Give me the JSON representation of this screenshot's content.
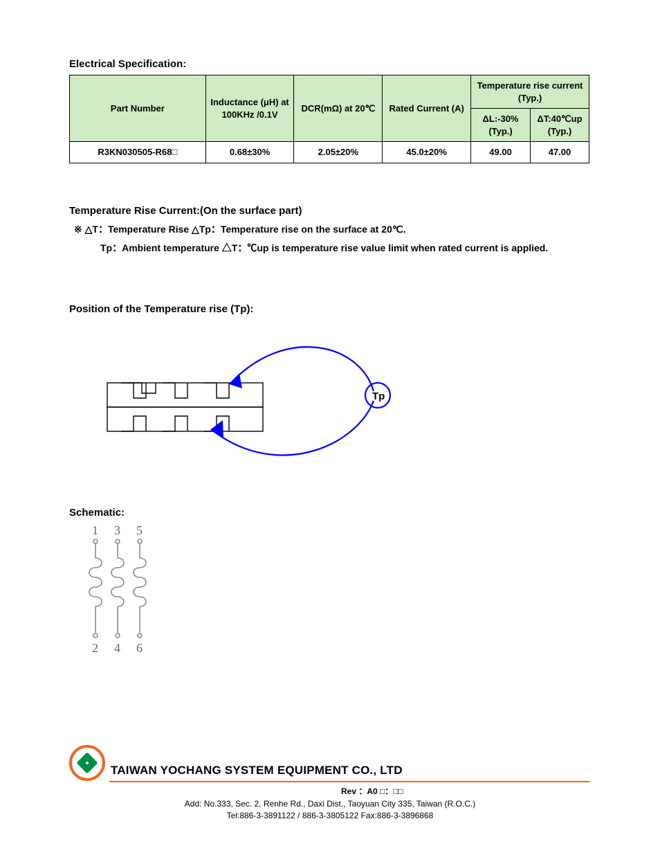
{
  "sections": {
    "electrical_spec": "Electrical Specification:",
    "temp_rise": "Temperature Rise Current:(On the surface part)",
    "tp_diagram": "Position of the Temperature rise (Tp):",
    "schematic": "Schematic:"
  },
  "table": {
    "headers": {
      "part": "Part Number",
      "inductance": "Inductance (μH) at 100KHz /0.1V",
      "dcr": "DCR(mΩ) at 20℃",
      "rated_current": "Rated Current (A)",
      "temp_rise_top": "Temperature rise current (Typ.)",
      "temp_rise_sub_left": "ΔL:-30% (Typ.)",
      "temp_rise_sub_right": "ΔT:40℃up (Typ.)"
    },
    "row": {
      "part_no": "R3KN030505-R68□",
      "inductance": "0.68±30%",
      "dcr": "2.05±20%",
      "rated": "45.0±20%",
      "tr_left": "49.00",
      "tr_right": "47.00"
    }
  },
  "temp_note": {
    "line1": {
      "label": "※    △T：Temperature Rise      △Tp：Temperature rise  on the surface  at 20℃."
    },
    "line2": {
      "label": "Tp：Ambient temperature    △T：℃up is temperature rise value limit when rated current is applied."
    }
  },
  "diagram": {
    "label": "Tp"
  },
  "schematic": {
    "pins_top": [
      "1",
      "3",
      "5"
    ],
    "pins_bottom": [
      "2",
      "4",
      "6"
    ]
  },
  "footer": {
    "company": "TAIWAN YOCHANG SYSTEM EQUIPMENT CO., LTD",
    "rev": "Rev ：A0    □：□□",
    "addr1": "Add: No.333, Sec. 2, Renhe Rd., Daxi Dist., Taoyuan City 335, Taiwan (R.O.C.)",
    "addr2": "Tel:886-3-3891122  /  886-3-3805122          Fax:886-3-3896868"
  }
}
